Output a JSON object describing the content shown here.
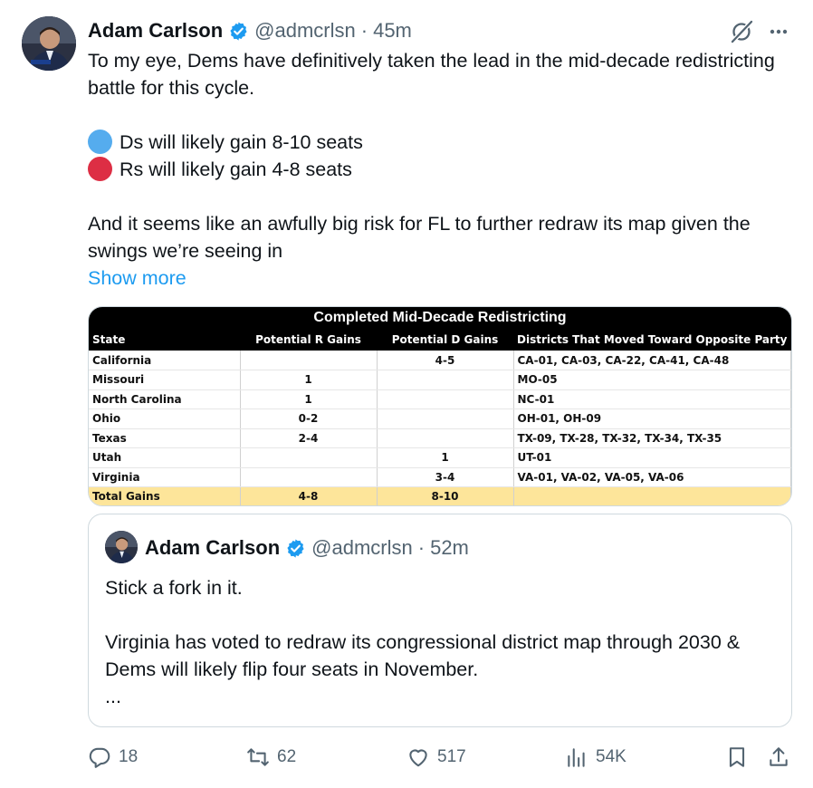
{
  "tweet": {
    "author_name": "Adam Carlson",
    "handle": "@admcrlsn",
    "separator": "·",
    "time": "45m",
    "lines": [
      "To my eye, Dems have definitively taken the lead in the mid-decade redistricting battle for this cycle.",
      "",
      "Ds will likely gain 8-10 seats",
      "Rs will likely gain 4-8 seats",
      "",
      "And it seems like an awfully big risk for FL to further redraw its map given the swings we’re seeing in"
    ],
    "show_more": "Show more"
  },
  "image_table": {
    "title": "Completed Mid-Decade Redistricting",
    "headers": [
      "State",
      "Potential R Gains",
      "Potential D Gains",
      "Districts That Moved Toward Opposite Party"
    ],
    "rows": [
      [
        "California",
        "",
        "4-5",
        "CA-01, CA-03, CA-22, CA-41, CA-48"
      ],
      [
        "Missouri",
        "1",
        "",
        "MO-05"
      ],
      [
        "North Carolina",
        "1",
        "",
        "NC-01"
      ],
      [
        "Ohio",
        "0-2",
        "",
        "OH-01, OH-09"
      ],
      [
        "Texas",
        "2-4",
        "",
        "TX-09, TX-28, TX-32, TX-34, TX-35"
      ],
      [
        "Utah",
        "",
        "1",
        "UT-01"
      ],
      [
        "Virginia",
        "",
        "3-4",
        "VA-01, VA-02, VA-05, VA-06"
      ]
    ],
    "total": [
      "Total Gains",
      "4-8",
      "8-10",
      ""
    ]
  },
  "quoted": {
    "author_name": "Adam Carlson",
    "handle": "@admcrlsn",
    "separator": "·",
    "time": "52m",
    "lines": [
      "Stick a fork in it.",
      "",
      "Virginia has voted to redraw its congressional district map through 2030 & Dems will likely flip four seats in November.",
      "..."
    ]
  },
  "actions": {
    "replies": "18",
    "reposts": "62",
    "likes": "517",
    "views": "54K"
  },
  "colors": {
    "accent": "#1d9bf0",
    "muted": "#536471",
    "blue_dot": "#55acee",
    "red_dot": "#dd2e44",
    "total_row": "#fde59a"
  },
  "icons": [
    "verified-badge-icon",
    "grok-icon",
    "more-icon",
    "reply-icon",
    "repost-icon",
    "like-icon",
    "views-icon",
    "bookmark-icon",
    "share-icon"
  ]
}
